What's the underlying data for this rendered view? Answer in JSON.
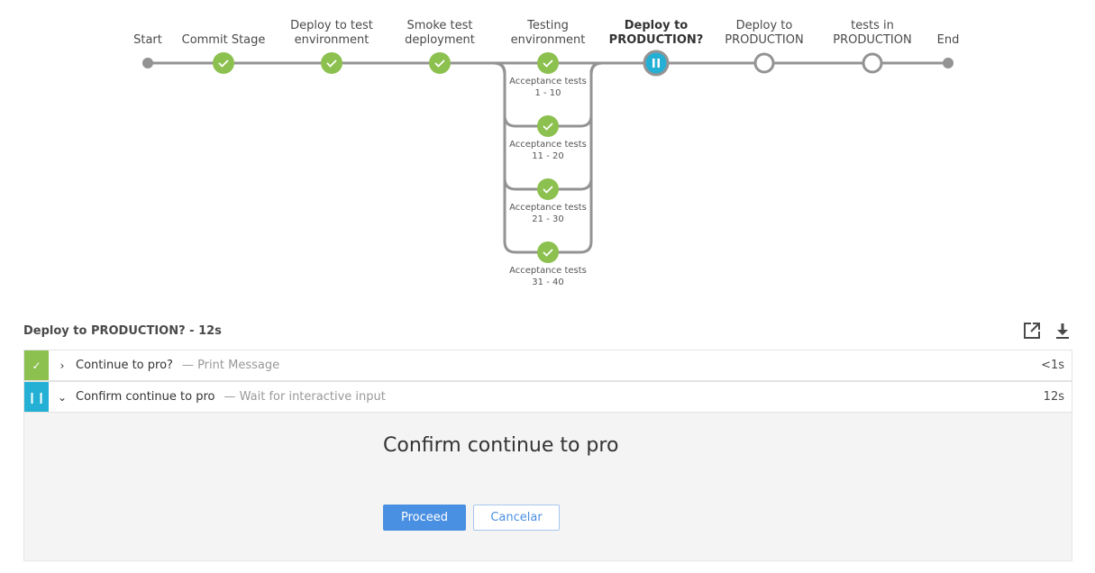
{
  "pipeline": {
    "main_nodes": [
      {
        "id": "start",
        "label": [
          "Start"
        ],
        "state": "terminal"
      },
      {
        "id": "commit",
        "label": [
          "Commit Stage"
        ],
        "state": "success"
      },
      {
        "id": "deploy-test",
        "label": [
          "Deploy to test",
          "environment"
        ],
        "state": "success"
      },
      {
        "id": "smoke",
        "label": [
          "Smoke test",
          "deployment"
        ],
        "state": "success"
      },
      {
        "id": "testing",
        "label": [
          "Testing",
          "environment"
        ],
        "state": "success"
      },
      {
        "id": "deploy-prod-q",
        "label": [
          "Deploy to",
          "PRODUCTION?"
        ],
        "state": "paused",
        "selected": true
      },
      {
        "id": "deploy-prod",
        "label": [
          "Deploy to",
          "PRODUCTION"
        ],
        "state": "not-built"
      },
      {
        "id": "tests-prod",
        "label": [
          "tests in",
          "PRODUCTION"
        ],
        "state": "not-built"
      },
      {
        "id": "end",
        "label": [
          "End"
        ],
        "state": "terminal"
      }
    ],
    "parallel_branches": [
      {
        "label": [
          "Acceptance tests",
          "1 - 10"
        ],
        "state": "success"
      },
      {
        "label": [
          "Acceptance tests",
          "11 - 20"
        ],
        "state": "success"
      },
      {
        "label": [
          "Acceptance tests",
          "21 - 30"
        ],
        "state": "success"
      },
      {
        "label": [
          "Acceptance tests",
          "31 - 40"
        ],
        "state": "success"
      }
    ],
    "colors": {
      "success": "#8cc04f",
      "paused": "#24b0d5",
      "line": "#949393",
      "terminal": "#949393"
    }
  },
  "stage_detail": {
    "title": "Deploy to PRODUCTION? - 12s",
    "icons": [
      "open-external-icon",
      "download-icon"
    ],
    "steps": [
      {
        "status": "success",
        "expanded": false,
        "name": "Continue to pro?",
        "description": "— Print Message",
        "duration": "<1s"
      },
      {
        "status": "paused",
        "expanded": true,
        "name": "Confirm continue to pro",
        "description": "— Wait for interactive input",
        "duration": "12s"
      }
    ],
    "input": {
      "message": "Confirm continue to pro",
      "proceed_label": "Proceed",
      "cancel_label": "Cancelar"
    }
  }
}
